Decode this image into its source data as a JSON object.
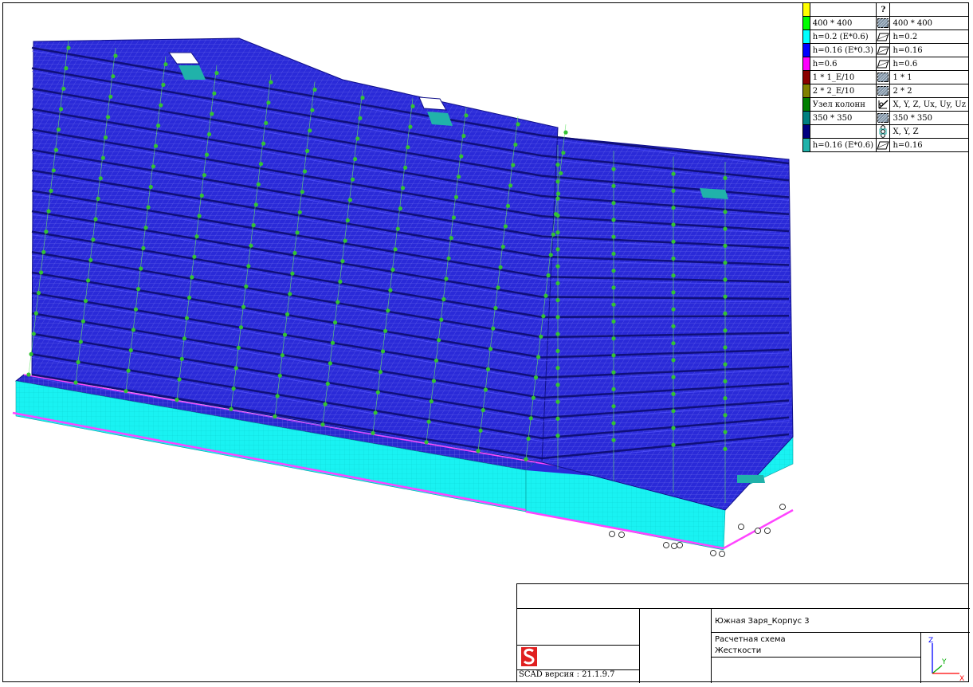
{
  "legend": {
    "rows": [
      {
        "color": "#ffff00",
        "label": "",
        "icon": "question-icon",
        "icon_text": "?",
        "right": ""
      },
      {
        "color": "#00ff00",
        "label": "400 * 400",
        "icon": "hatched-square-icon",
        "right": "400 * 400"
      },
      {
        "color": "#00ffff",
        "label": "h=0.2 (E*0.6)",
        "icon": "plate-icon",
        "right": "h=0.2"
      },
      {
        "color": "#0000ff",
        "label": "h=0.16 (E*0.3)",
        "icon": "plate-icon",
        "right": "h=0.16"
      },
      {
        "color": "#ff00ff",
        "label": "h=0.6",
        "icon": "plate-icon",
        "right": "h=0.6"
      },
      {
        "color": "#8b0000",
        "label": "1 * 1_E/10",
        "icon": "hatched-square-icon",
        "right": "1 * 1"
      },
      {
        "color": "#808000",
        "label": "2 * 2_E/10",
        "icon": "hatched-square-icon",
        "right": "2 * 2"
      },
      {
        "color": "#008000",
        "label": "Узел колонн",
        "icon": "constraint-axes-icon",
        "right": "X, Y, Z, Ux, Uy, Uz"
      },
      {
        "color": "#008080",
        "label": "350 * 350",
        "icon": "hatched-square-icon",
        "right": "350 * 350"
      },
      {
        "color": "#000080",
        "label": "",
        "icon": "support-symbol-icon",
        "right": "X, Y, Z"
      },
      {
        "color": "#20b2aa",
        "label": "h=0.16 (E*0.6)",
        "icon": "plate-icon",
        "right": "h=0.16"
      }
    ]
  },
  "title_block": {
    "project": "Южная Заря_Корпус 3",
    "drawing_name": "Расчетная схема",
    "sheet_subtitle": "Жесткости",
    "version": "SCAD версия : 21.1.9.7",
    "axis_x": "X",
    "axis_y": "Y",
    "axis_z": "Z"
  },
  "colors": {
    "slab": "#2323d2",
    "slab_dark": "#13139a",
    "mesh": "#c8c8ff",
    "node": "#34c234",
    "foundation": "#16f0f0",
    "foundation_edge": "#ff44ff",
    "logo": "#e02020"
  }
}
